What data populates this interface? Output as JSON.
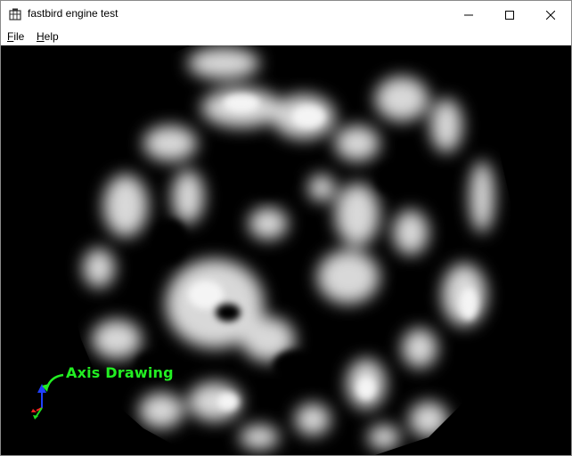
{
  "window": {
    "title": "fastbird engine test"
  },
  "menu": {
    "items": [
      {
        "mnemonic": "F",
        "rest": "ile"
      },
      {
        "mnemonic": "H",
        "rest": "elp"
      }
    ]
  },
  "viewport": {
    "axis_label": "Axis Drawing",
    "axis_label_color": "#22ee22",
    "background": "#000000",
    "axis_colors": {
      "x": "#ff2020",
      "y": "#20dd20",
      "z": "#2040ff"
    }
  },
  "icons": {
    "app": "app-window-icon",
    "minimize": "minimize-icon",
    "maximize": "maximize-icon",
    "close": "close-icon"
  }
}
